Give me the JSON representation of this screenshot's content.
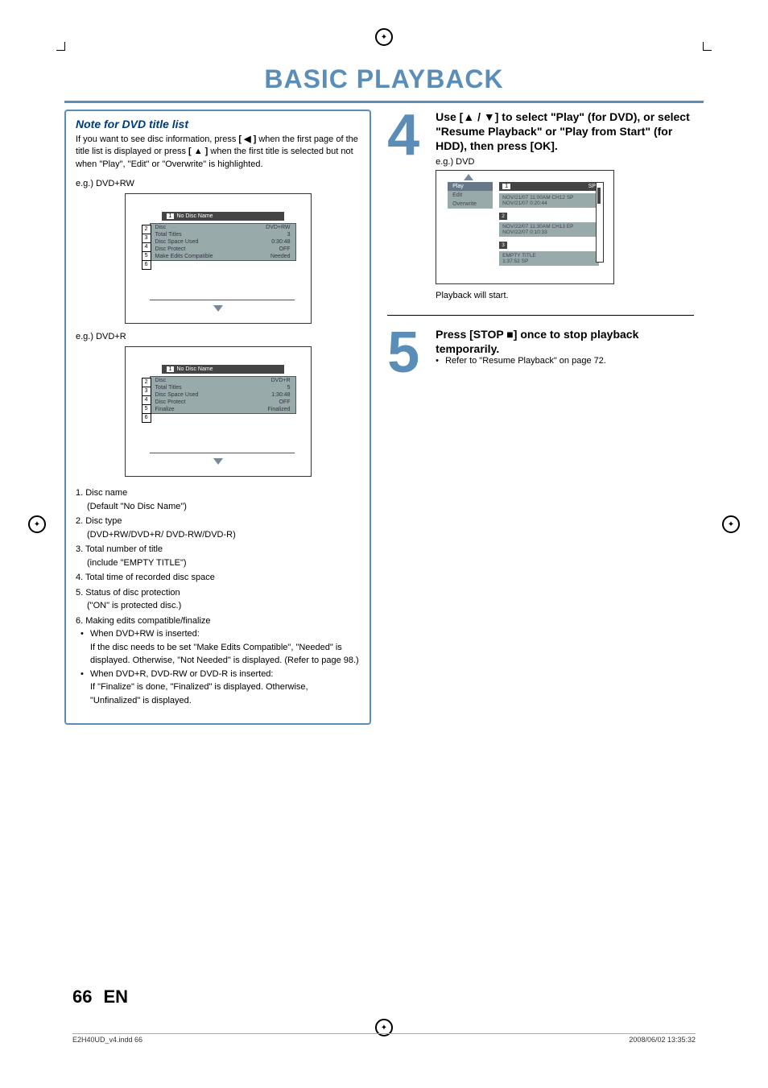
{
  "title": "BASIC PLAYBACK",
  "note": {
    "heading": "Note for DVD title list",
    "body_pre": "If you want to see disc information, press ",
    "body_btn1": "[ ◀ ]",
    "body_mid": " when the first page of the title list is displayed or press ",
    "body_btn2": "[ ▲ ]",
    "body_post": " when the first title is selected but not when \"Play\", \"Edit\" or \"Overwrite\" is highlighted."
  },
  "eg_rw": "e.g.) DVD+RW",
  "eg_r": "e.g.) DVD+R",
  "panel_header_num": "1",
  "panel_header_text": "No Disc Name",
  "panel_rw": {
    "rows": [
      {
        "label": "Disc",
        "val": "DVD+RW"
      },
      {
        "label": "Total Titles",
        "val": "3"
      },
      {
        "label": "Disc Space Used",
        "val": "0:30:48"
      },
      {
        "label": "Disc Protect",
        "val": "OFF"
      },
      {
        "label": "Make Edits Compatible",
        "val": "Needed"
      }
    ],
    "callouts": [
      "2",
      "3",
      "4",
      "5",
      "6"
    ]
  },
  "panel_r": {
    "rows": [
      {
        "label": "Disc",
        "val": "DVD+R"
      },
      {
        "label": "Total Titles",
        "val": "5"
      },
      {
        "label": "Disc Space Used",
        "val": "1:30:48"
      },
      {
        "label": "Disc Protect",
        "val": "OFF"
      },
      {
        "label": "Finalize",
        "val": "Finalized"
      }
    ],
    "callouts": [
      "2",
      "3",
      "4",
      "5",
      "6"
    ]
  },
  "legend": {
    "l1": "1. Disc name",
    "l1s": "(Default \"No Disc Name\")",
    "l2": "2. Disc type",
    "l2s": "(DVD+RW/DVD+R/ DVD-RW/DVD-R)",
    "l3": "3. Total number of title",
    "l3s": "(include \"EMPTY TITLE\")",
    "l4": "4. Total time of recorded disc space",
    "l5": "5. Status of disc protection",
    "l5s": "(\"ON\" is protected disc.)",
    "l6": "6. Making edits compatible/finalize",
    "b1a": "When DVD+RW is inserted:",
    "b1b": "If the disc needs to be set \"Make Edits Compatible\", \"Needed\" is displayed. Otherwise, \"Not Needed\" is displayed. (Refer to page 98.)",
    "b2a": "When DVD+R, DVD-RW or DVD-R is inserted:",
    "b2b": "If \"Finalize\" is done, \"Finalized\"  is displayed. Otherwise, \"Unfinalized\" is displayed."
  },
  "step4": {
    "num": "4",
    "head": "Use [▲ / ▼] to select \"Play\" (for DVD), or select \"Resume Playback\" or \"Play from Start\" (for HDD), then press [OK].",
    "eg": "e.g.) DVD",
    "after": "Playback will start."
  },
  "sp": {
    "menu": [
      "Play",
      "Edit",
      "Overwrite"
    ],
    "hdr_num": "1",
    "hdr_sp": "SP",
    "e1a": "NOV/21/07  11:00AM CH12  SP",
    "e1b": "NOV/21/07    0:20:44",
    "n2": "2",
    "e2a": "NOV/22/07  11:30AM CH13  EP",
    "e2b": "NOV/22/07    0:10:33",
    "n3": "3",
    "e3a": "EMPTY TITLE",
    "e3b": "1:37:52  SP"
  },
  "step5": {
    "num": "5",
    "head": "Press [STOP ■] once to stop playback temporarily.",
    "bullet": "Refer to \"Resume Playback\" on page 72."
  },
  "page_num": "66",
  "page_lang": "EN",
  "footer_left": "E2H40UD_v4.indd   66",
  "footer_right": "2008/06/02   13:35:32"
}
